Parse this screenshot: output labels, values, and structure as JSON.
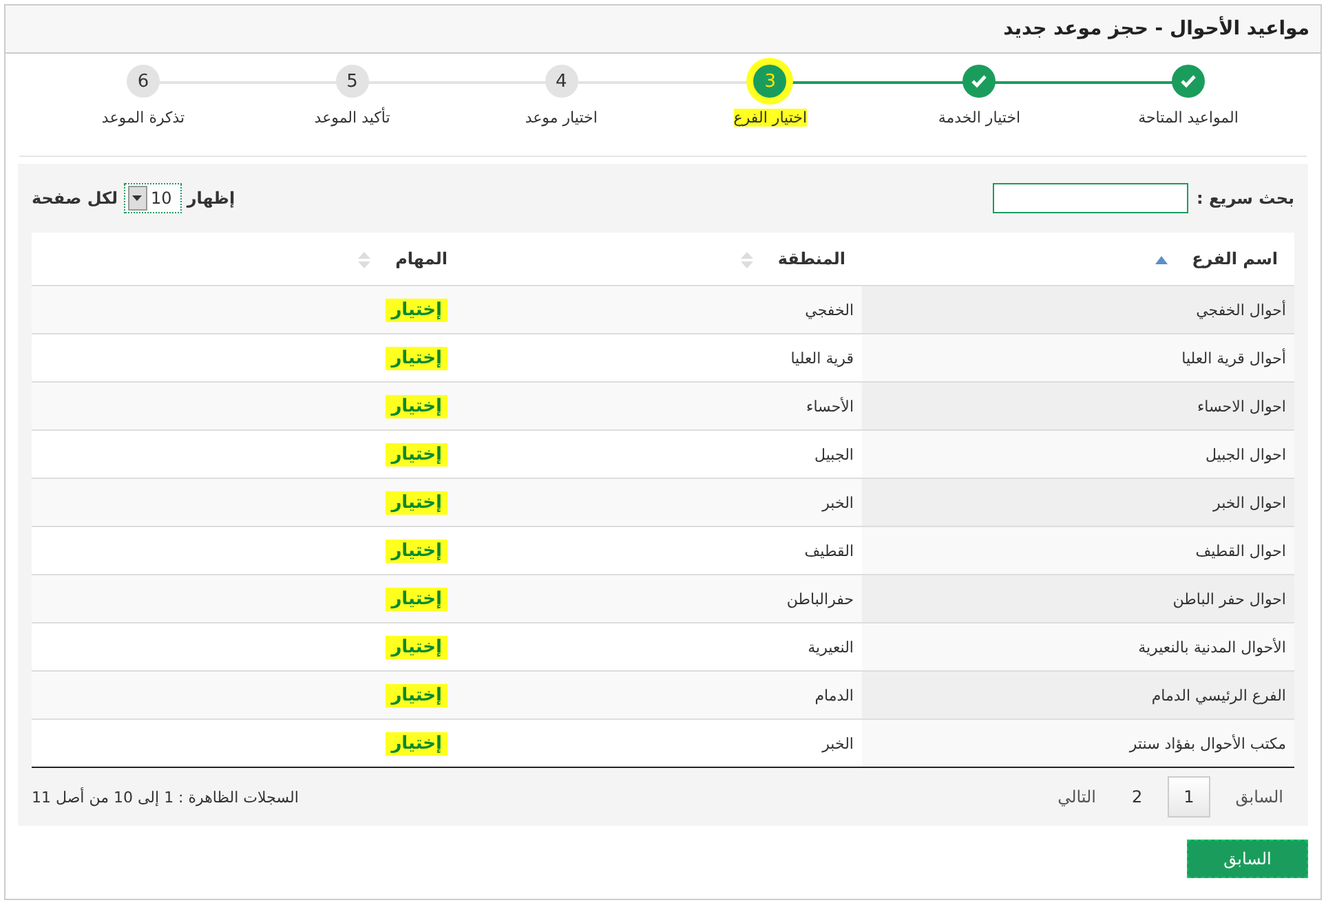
{
  "window": {
    "title": "مواعيد الأحوال - حجز موعد جديد"
  },
  "steps": [
    {
      "label": "المواعيد المتاحة",
      "done": true,
      "current": false,
      "highlighted": false
    },
    {
      "label": "اختيار الخدمة",
      "done": true,
      "current": false,
      "highlighted": false
    },
    {
      "number": "3",
      "label": "اختيار الفرع",
      "done": false,
      "current": true,
      "highlighted": true
    },
    {
      "number": "4",
      "label": "اختيار موعد",
      "done": false,
      "current": false,
      "highlighted": false
    },
    {
      "number": "5",
      "label": "تأكيد الموعد",
      "done": false,
      "current": false,
      "highlighted": false
    },
    {
      "number": "6",
      "label": "تذكرة الموعد",
      "done": false,
      "current": false,
      "highlighted": false
    }
  ],
  "search": {
    "label": "بحث سريع :"
  },
  "page_length": {
    "label_before": "إظهار",
    "value": "10",
    "label_after": "لكل صفحة"
  },
  "table": {
    "columns": [
      {
        "label": "اسم الفرع",
        "sorted": true
      },
      {
        "label": "المنطقة",
        "sorted": false
      },
      {
        "label": "المهام",
        "sorted": false
      }
    ],
    "rows": [
      {
        "branch": "أحوال الخفجي",
        "region": "الخفجي",
        "action": "إختيار",
        "highlighted": true
      },
      {
        "branch": "أحوال قرية العليا",
        "region": "قرية العليا",
        "action": "إختيار",
        "highlighted": true
      },
      {
        "branch": "احوال الاحساء",
        "region": "الأحساء",
        "action": "إختيار",
        "highlighted": true
      },
      {
        "branch": "احوال الجبيل",
        "region": "الجبيل",
        "action": "إختيار",
        "highlighted": true
      },
      {
        "branch": "احوال الخبر",
        "region": "الخبر",
        "action": "إختيار",
        "highlighted": true
      },
      {
        "branch": "احوال القطيف",
        "region": "القطيف",
        "action": "إختيار",
        "highlighted": true
      },
      {
        "branch": "احوال حفر الباطن",
        "region": "حفرالباطن",
        "action": "إختيار",
        "highlighted": true
      },
      {
        "branch": "الأحوال المدنية بالنعيرية",
        "region": "النعيرية",
        "action": "إختيار",
        "highlighted": true
      },
      {
        "branch": "الفرع الرئيسي الدمام",
        "region": "الدمام",
        "action": "إختيار",
        "highlighted": true
      },
      {
        "branch": "مكتب الأحوال بفؤاد سنتر",
        "region": "الخبر",
        "action": "إختيار",
        "highlighted": true
      }
    ]
  },
  "pagination": {
    "previous": "السابق",
    "pages": [
      {
        "label": "1",
        "selected": true
      },
      {
        "label": "2",
        "selected": false
      }
    ],
    "next": "التالي"
  },
  "info": "السجلات الظاهرة : 1 إلى 10 من أصل 11",
  "back_button": "السابق"
}
